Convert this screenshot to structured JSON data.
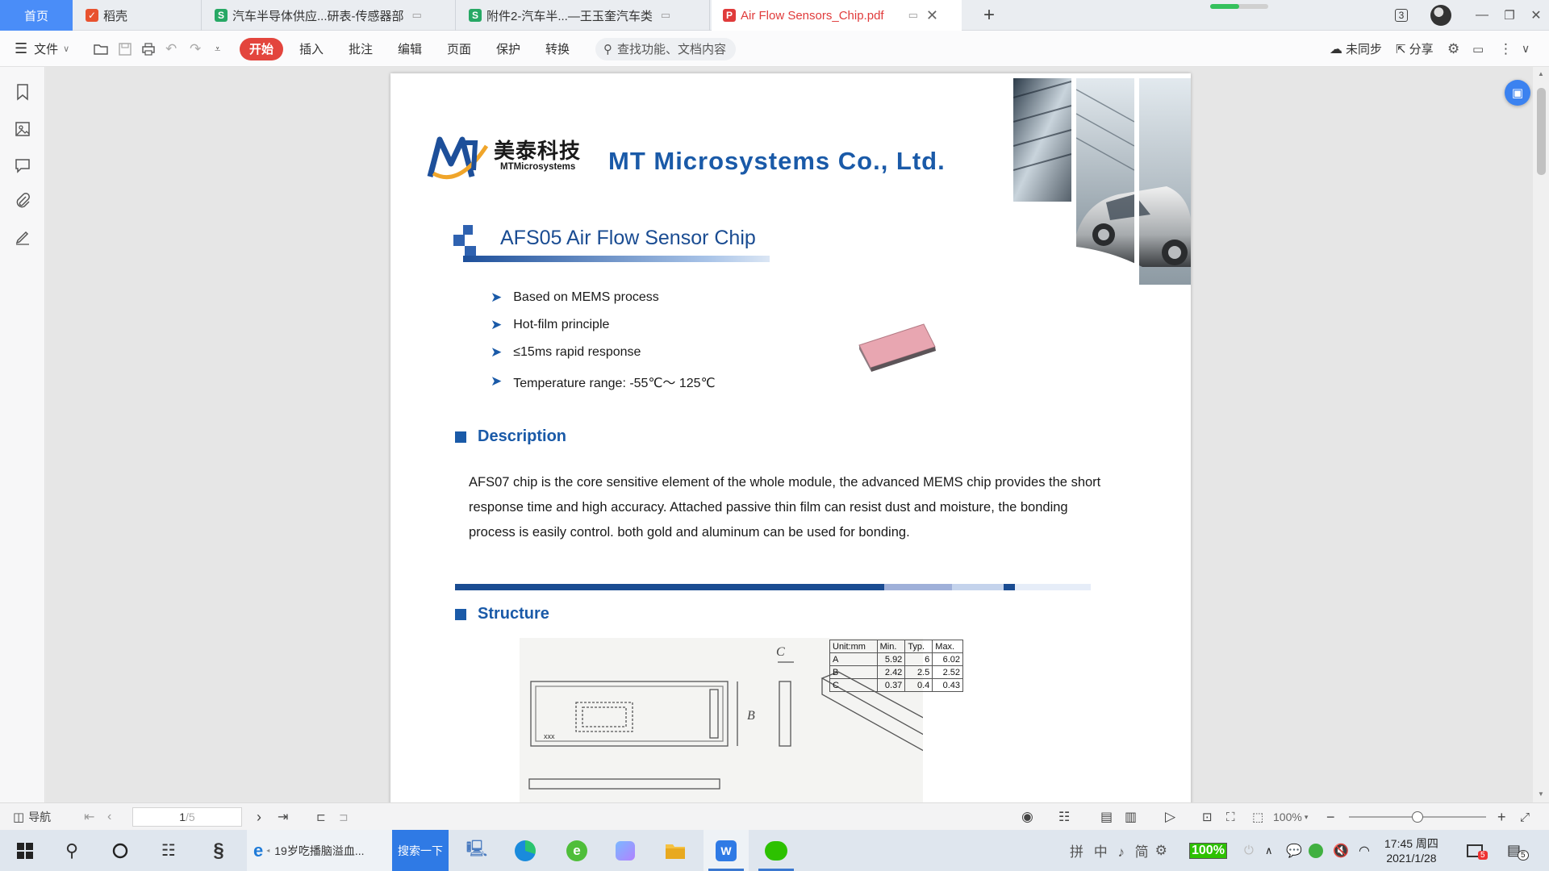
{
  "tabs": {
    "home": "首页",
    "items": [
      {
        "label": "稻壳"
      },
      {
        "label": "汽车半导体供应...研表-传感器部"
      },
      {
        "label": "附件2-汽车半...—王玉奎汽车类"
      },
      {
        "label": "Air Flow Sensors_Chip.pdf"
      }
    ],
    "window_count": "3"
  },
  "toolbar": {
    "file": "文件",
    "start": "开始",
    "menu": [
      "插入",
      "批注",
      "编辑",
      "页面",
      "保护",
      "转换"
    ],
    "search_placeholder": "查找功能、文档内容",
    "unsynced": "未同步",
    "share": "分享"
  },
  "document": {
    "logo_cn": "美泰科技",
    "logo_en": "MTMicrosystems",
    "company": "MT Microsystems Co., Ltd.",
    "chip_title": "AFS05 Air Flow Sensor Chip",
    "bullets": [
      "Based on MEMS process",
      "Hot-film principle",
      "≤15ms rapid response",
      "Temperature range: -55℃～ 125℃"
    ],
    "description_title": "Description",
    "description_text": "AFS07 chip is the core sensitive element of the whole module, the advanced MEMS chip provides the short response time and high accuracy. Attached passive thin film can resist dust and moisture, the bonding process is easily control. both gold and aluminum can be used for bonding.",
    "structure_title": "Structure",
    "drawing_labels": {
      "c": "C",
      "b": "B",
      "marks": "xxx"
    },
    "dim_table": {
      "headers": [
        "Unit:mm",
        "Min.",
        "Typ.",
        "Max."
      ],
      "rows": [
        [
          "A",
          "5.92",
          "6",
          "6.02"
        ],
        [
          "B",
          "2.42",
          "2.5",
          "2.52"
        ],
        [
          "C",
          "0.37",
          "0.4",
          "0.43"
        ]
      ]
    }
  },
  "statusbar": {
    "nav": "导航",
    "page_current": "1",
    "page_total": "/5",
    "zoom": "100%"
  },
  "taskbar": {
    "browser_title": "19岁吃播脑溢血...",
    "search_button": "搜索一下",
    "ime": "拼 中 ♪ 简",
    "battery": "100%",
    "time": "17:45 周四",
    "date": "2021/1/28",
    "notif_count": "5",
    "mail_count": "5"
  },
  "colors": {
    "accent": "#1a5aa8",
    "start_button": "#e3453d",
    "home_tab": "#4a8df8",
    "active_tab_text": "#e03b3b",
    "chip": "#e8a6b1"
  }
}
